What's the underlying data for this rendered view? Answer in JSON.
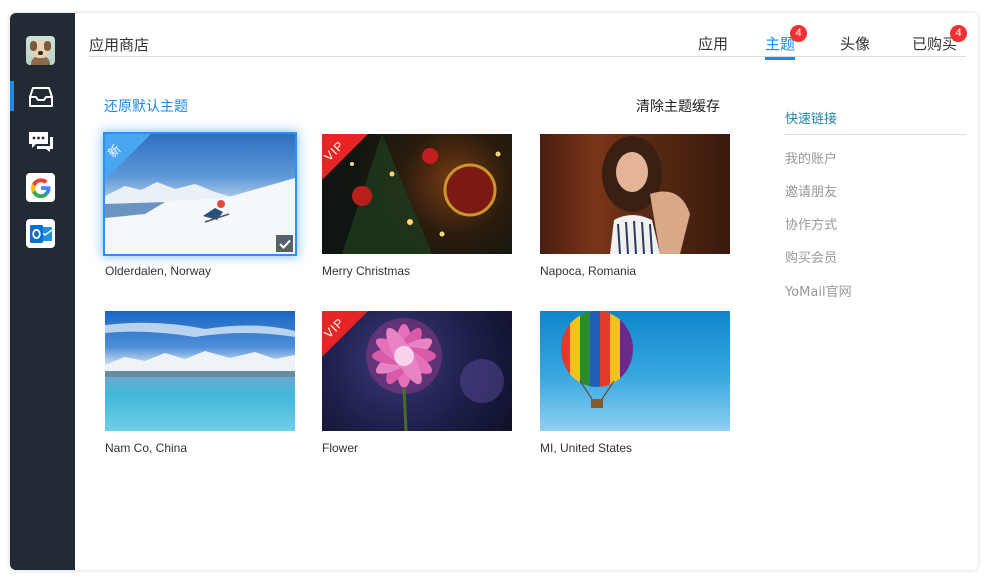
{
  "header": {
    "title": "应用商店",
    "tabs": [
      {
        "label": "应用"
      },
      {
        "label": "主题",
        "badge": "4"
      },
      {
        "label": "头像"
      },
      {
        "label": "已购买",
        "badge": "4"
      }
    ]
  },
  "actions": {
    "restore_default": "还原默认主题",
    "clear_cache": "清除主题缓存"
  },
  "themes": [
    {
      "caption": "Olderdalen, Norway",
      "flag": "新"
    },
    {
      "caption": "Merry Christmas",
      "flag": "VIP"
    },
    {
      "caption": "Napoca, Romania"
    },
    {
      "caption": "Nam Co, China"
    },
    {
      "caption": "Flower",
      "flag": "VIP"
    },
    {
      "caption": "MI, United States"
    }
  ],
  "quick_links": {
    "title": "快速链接",
    "items": [
      "我的账户",
      "邀请朋友",
      "协作方式",
      "购买会员",
      "YoMail官网"
    ]
  },
  "colors": {
    "accent": "#1e88e5",
    "badge": "#f23030",
    "rail": "#222a33",
    "vip_flag": "#e82424"
  },
  "icons": [
    "user-avatar-icon",
    "inbox-icon",
    "chat-icon",
    "google-icon",
    "outlook-icon",
    "checkmark-icon"
  ]
}
